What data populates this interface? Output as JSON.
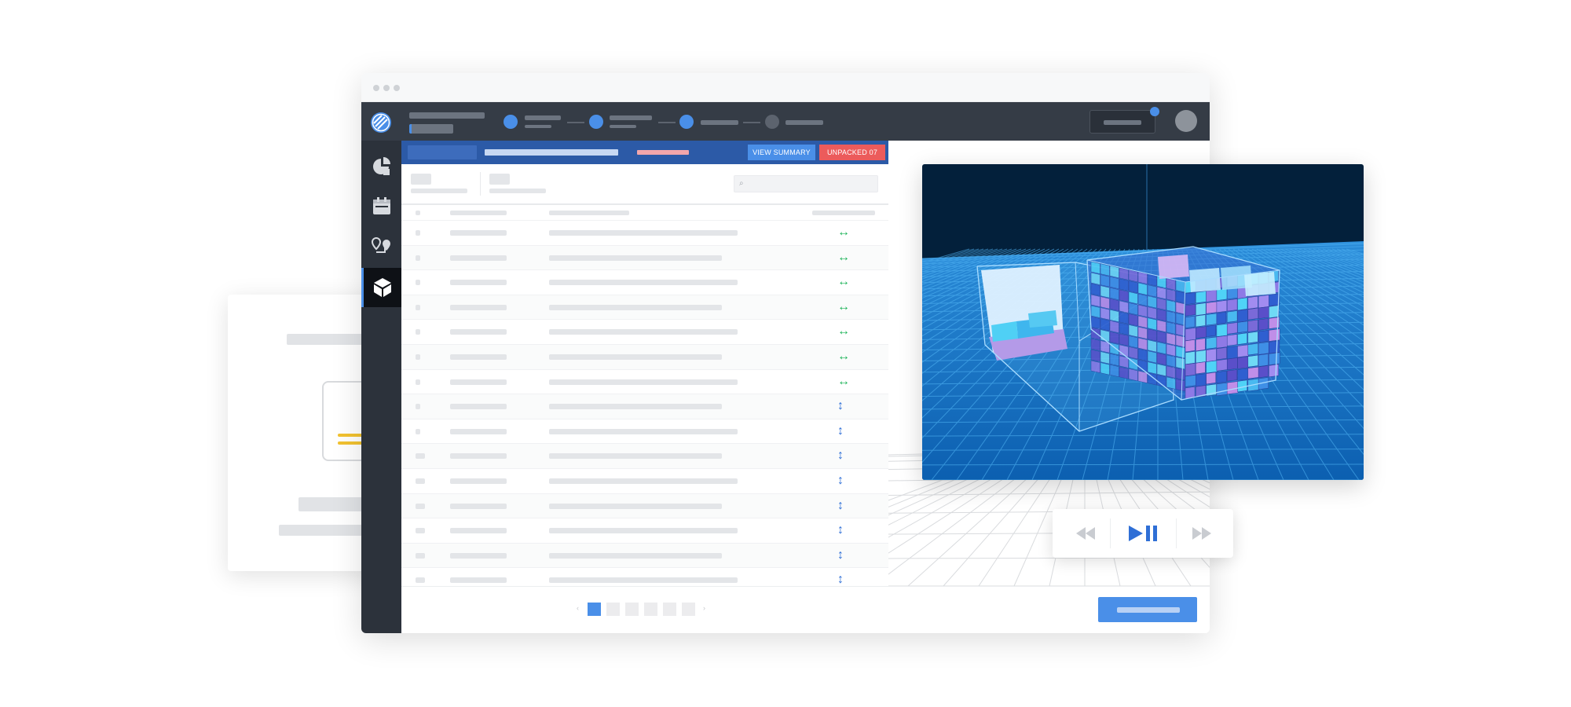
{
  "window": {
    "title_dots": 3
  },
  "content_header": {
    "view_summary_label": "VIEW SUMMARY",
    "unpacked_label": "UNPACKED 07"
  },
  "table": {
    "row_count": 15,
    "arrows": [
      "↔",
      "↔",
      "↔",
      "↔",
      "↔",
      "↔",
      "↔",
      "↕",
      "↕",
      "↕",
      "↕",
      "↕",
      "↕",
      "↕",
      "↕"
    ]
  },
  "pagination": {
    "pages": 6,
    "active_page": 1,
    "prev_icon": "‹",
    "next_icon": "›"
  },
  "colors": {
    "accent": "#4a8fe8",
    "header_blue": "#2c5aa7",
    "danger": "#ec5b5b",
    "nav_dark": "#353c46",
    "sidebar_dark": "#2c323b",
    "viewport_bg": "#03203b",
    "arrow_green": "#1fb45a",
    "arrow_blue": "#2f6fd6"
  },
  "icons": {
    "search": "search-icon",
    "logo": "striped-globe-icon",
    "sidebar": [
      "pie-chart-icon",
      "calendar-icon",
      "route-pin-icon",
      "cube-icon"
    ],
    "player": [
      "rewind-icon",
      "play-pause-icon",
      "fast-forward-icon"
    ]
  }
}
